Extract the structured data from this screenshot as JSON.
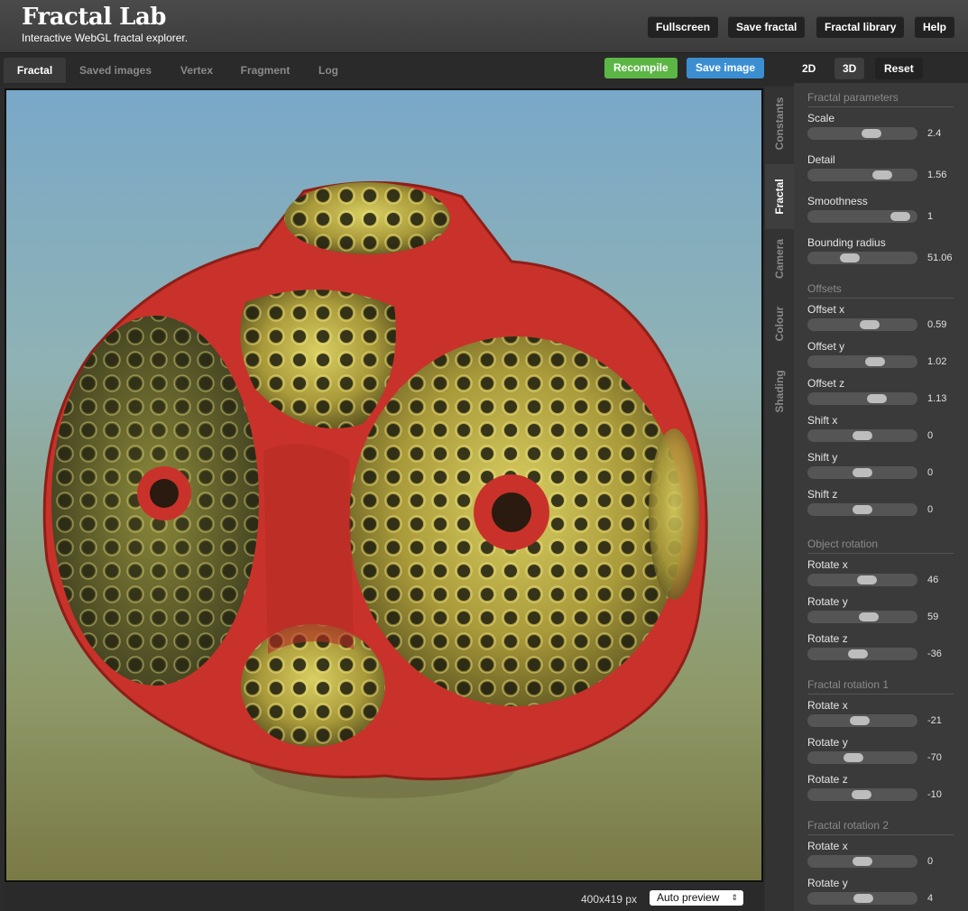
{
  "header": {
    "title": "Fractal Lab",
    "tagline": "Interactive WebGL fractal explorer.",
    "buttons": [
      "Fullscreen",
      "Save fractal",
      "Fractal library",
      "Help"
    ]
  },
  "tabs": [
    "Fractal",
    "Saved images",
    "Vertex",
    "Fragment",
    "Log"
  ],
  "actions": {
    "recompile": "Recompile",
    "save_image": "Save image"
  },
  "mode_buttons": [
    "2D",
    "3D",
    "Reset"
  ],
  "side_tabs": [
    "Constants",
    "Fractal",
    "Camera",
    "Colour",
    "Shading"
  ],
  "status": {
    "dimensions": "400x419 px",
    "preview": "Auto preview"
  },
  "colors": {
    "recompile": "#5cb645",
    "save_image": "#3b8fd1",
    "fractal_red": "#c8322a",
    "fractal_yellow": "#c8b84a"
  },
  "params": {
    "fractal": {
      "title": "Fractal parameters",
      "items": [
        {
          "label": "Scale",
          "value": "2.4",
          "pos": 0.6
        },
        {
          "label": "Detail",
          "value": "1.56",
          "pos": 0.72
        },
        {
          "label": "Smoothness",
          "value": "1",
          "pos": 0.92
        },
        {
          "label": "Bounding radius",
          "value": "51.06",
          "pos": 0.36
        }
      ]
    },
    "offsets": {
      "title": "Offsets",
      "items": [
        {
          "label": "Offset x",
          "value": "0.59",
          "pos": 0.58
        },
        {
          "label": "Offset y",
          "value": "1.02",
          "pos": 0.64
        },
        {
          "label": "Offset z",
          "value": "1.13",
          "pos": 0.66
        },
        {
          "label": "Shift x",
          "value": "0",
          "pos": 0.5
        },
        {
          "label": "Shift y",
          "value": "0",
          "pos": 0.5
        },
        {
          "label": "Shift z",
          "value": "0",
          "pos": 0.5
        }
      ]
    },
    "object_rotation": {
      "title": "Object rotation",
      "items": [
        {
          "label": "Rotate x",
          "value": "46",
          "pos": 0.55
        },
        {
          "label": "Rotate y",
          "value": "59",
          "pos": 0.57
        },
        {
          "label": "Rotate z",
          "value": "-36",
          "pos": 0.45
        }
      ]
    },
    "fractal_rotation_1": {
      "title": "Fractal rotation 1",
      "items": [
        {
          "label": "Rotate x",
          "value": "-21",
          "pos": 0.47
        },
        {
          "label": "Rotate y",
          "value": "-70",
          "pos": 0.4
        },
        {
          "label": "Rotate z",
          "value": "-10",
          "pos": 0.49
        }
      ]
    },
    "fractal_rotation_2": {
      "title": "Fractal rotation 2",
      "items": [
        {
          "label": "Rotate x",
          "value": "0",
          "pos": 0.5
        },
        {
          "label": "Rotate y",
          "value": "4",
          "pos": 0.51
        }
      ]
    }
  }
}
